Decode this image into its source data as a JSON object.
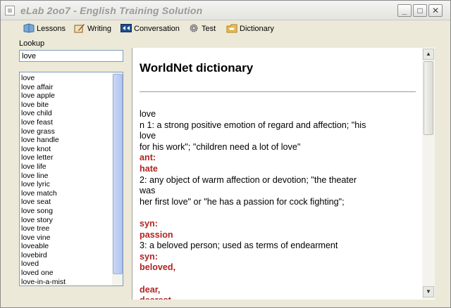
{
  "window": {
    "title": "eLab 2oo7 - English Training Solution",
    "min_glyph": "_",
    "max_glyph": "□",
    "close_glyph": "✕"
  },
  "toolbar": {
    "items": [
      {
        "label": "Lessons",
        "icon": "lessons-icon",
        "color": "#4a7fb5"
      },
      {
        "label": "Writing",
        "icon": "writing-icon",
        "color": "#8b5a2b"
      },
      {
        "label": "Conversation",
        "icon": "conversation-icon",
        "color": "#1f4f8f"
      },
      {
        "label": "Test",
        "icon": "test-gear-icon",
        "color": "#6d6d6d"
      },
      {
        "label": "Dictionary",
        "icon": "dictionary-icon",
        "color": "#d9a520"
      }
    ]
  },
  "lookup": {
    "label": "Lookup",
    "value": "love"
  },
  "wordlist": {
    "items": [
      "love",
      "love affair",
      "love apple",
      "love bite",
      "love child",
      "love feast",
      "love grass",
      "love handle",
      "love knot",
      "love letter",
      "love life",
      "love line",
      "love lyric",
      "love match",
      "love seat",
      "love song",
      "love story",
      "love tree",
      "love vine",
      "loveable",
      "lovebird",
      "loved",
      "loved one",
      "love-in-a-mist"
    ]
  },
  "dictionary": {
    "title": "WorldNet dictionary",
    "lines": [
      {
        "text": "love",
        "style": "normal"
      },
      {
        "text": "n 1: a strong positive emotion of regard and affection; \"his",
        "style": "normal"
      },
      {
        "text": "love",
        "style": "normal"
      },
      {
        "text": "for his work\"; \"children need a lot of love\"",
        "style": "normal"
      },
      {
        "text": "ant:",
        "style": "red"
      },
      {
        "text": "hate",
        "style": "red"
      },
      {
        "text": "2: any object of warm affection or devotion; \"the theater",
        "style": "normal"
      },
      {
        "text": "was",
        "style": "normal"
      },
      {
        "text": "her first love\" or \"he has a passion for cock fighting\";",
        "style": "normal"
      },
      {
        "text": "",
        "style": "gap"
      },
      {
        "text": "syn:",
        "style": "red"
      },
      {
        "text": "passion",
        "style": "red"
      },
      {
        "text": "3: a beloved person; used as terms of endearment",
        "style": "normal"
      },
      {
        "text": "syn:",
        "style": "red"
      },
      {
        "text": "beloved,",
        "style": "red"
      },
      {
        "text": "",
        "style": "gap"
      },
      {
        "text": "dear,",
        "style": "red"
      },
      {
        "text": "dearest",
        "style": "red"
      }
    ]
  },
  "scroll": {
    "up_glyph": "▲",
    "down_glyph": "▼"
  }
}
